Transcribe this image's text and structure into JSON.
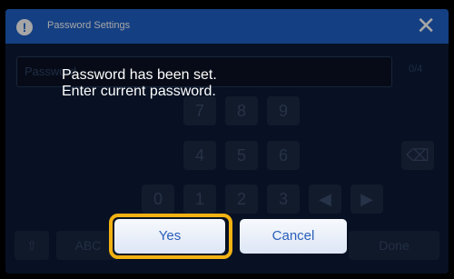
{
  "title_bar": {
    "title": "Password Settings",
    "alert_icon": "!",
    "close_icon": "✕"
  },
  "password_field": {
    "placeholder": "Password",
    "counter": "0/4"
  },
  "keypad": {
    "row1": [
      "7",
      "8",
      "9"
    ],
    "row2": [
      "4",
      "5",
      "6"
    ],
    "row3": [
      "0",
      "1",
      "2",
      "3"
    ],
    "nav": {
      "left": "◀",
      "right": "▶"
    },
    "backspace": "⌫"
  },
  "bottom_bar": {
    "left": "⇧",
    "abc": "ABC",
    "done": "Done"
  },
  "dialog": {
    "line1": "Password has been set.",
    "line2": "Enter current password.",
    "yes_label": "Yes",
    "cancel_label": "Cancel"
  },
  "colors": {
    "title_bar": "#1f62c8",
    "background": "#0c1b36",
    "highlight": "#f2b212",
    "button_text": "#2a5fba"
  }
}
